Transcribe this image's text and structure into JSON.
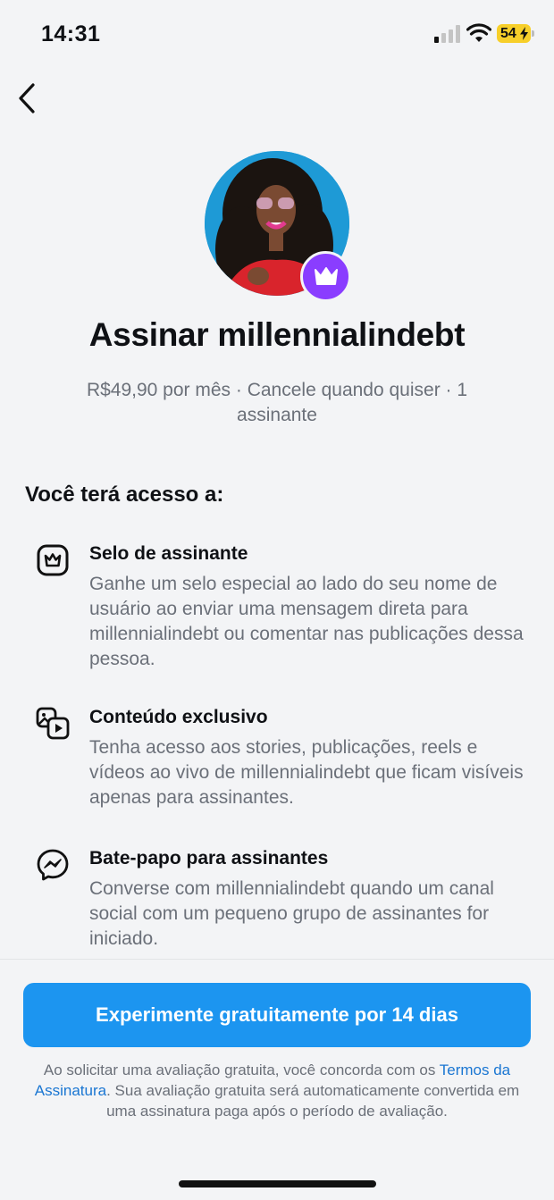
{
  "status_bar": {
    "time": "14:31",
    "battery": "54",
    "icons": [
      "signal-icon",
      "wifi-icon",
      "battery-icon"
    ]
  },
  "nav": {
    "back_icon": "chevron-left-icon"
  },
  "profile": {
    "avatar_alt": "millennialindebt",
    "badge_icon": "crown-icon"
  },
  "title": "Assinar millennialindebt",
  "subtitle": "R$49,90 por mês · Cancele quando quiser · 1 assinante",
  "section_heading": "Você terá acesso a:",
  "benefits": [
    {
      "icon": "subscriber-badge-icon",
      "title": "Selo de assinante",
      "description": "Ganhe um selo especial ao lado do seu nome de usuário ao enviar uma mensagem direta para millennialindebt ou comentar nas publicações dessa pessoa."
    },
    {
      "icon": "exclusive-content-icon",
      "title": "Conteúdo exclusivo",
      "description": "Tenha acesso aos stories, publicações, reels e vídeos ao vivo de millennialindebt que ficam visíveis apenas para assinantes."
    },
    {
      "icon": "messenger-icon",
      "title": "Bate-papo para assinantes",
      "description": "Converse com millennialindebt quando um canal social com um pequeno grupo de assinantes for iniciado."
    }
  ],
  "cta": {
    "label": "Experimente gratuitamente por 14 dias"
  },
  "legal": {
    "before_link": "Ao solicitar uma avaliação gratuita, você concorda com os ",
    "link": "Termos da Assinatura",
    "after_link": ". Sua avaliação gratuita será automaticamente convertida em uma assinatura paga após o período de avaliação."
  },
  "colors": {
    "accent": "#1c95f0",
    "badge": "#8a3dff",
    "link": "#1a76d2",
    "background": "#f3f4f6"
  }
}
